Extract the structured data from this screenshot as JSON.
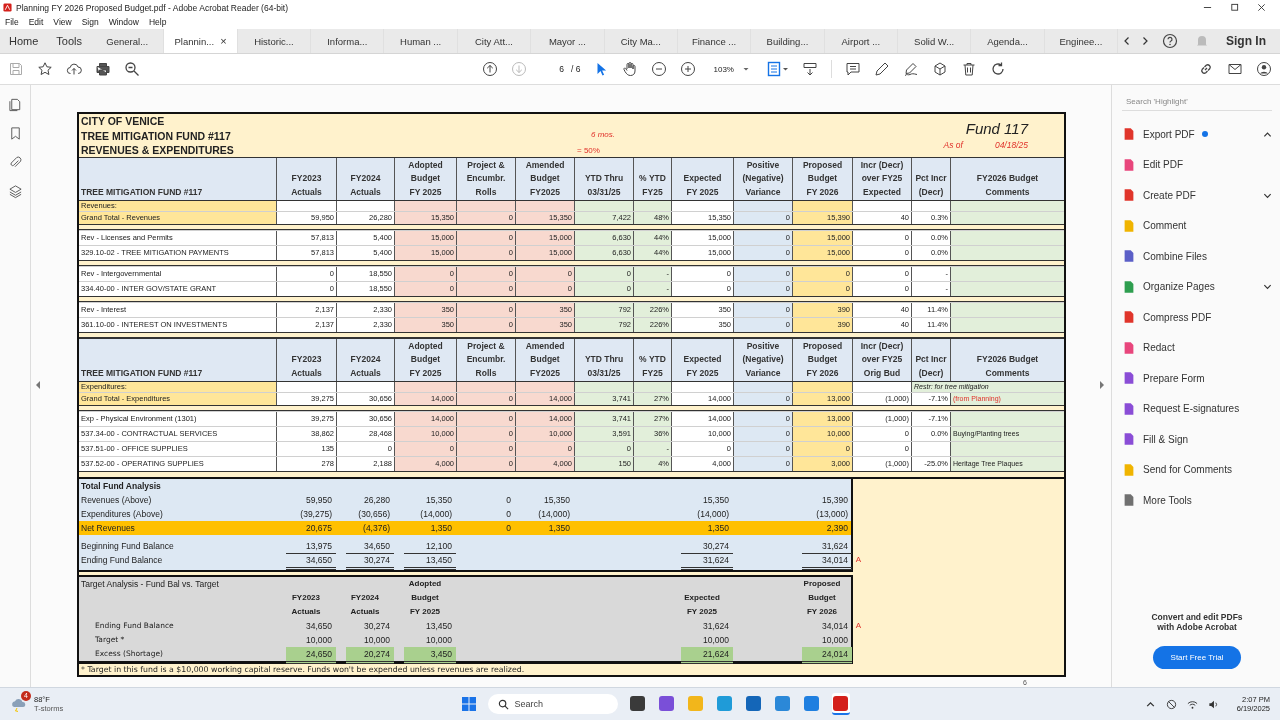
{
  "window": {
    "title": "Planning FY 2026 Proposed Budget.pdf - Adobe Acrobat Reader (64-bit)"
  },
  "menu": [
    "File",
    "Edit",
    "View",
    "Sign",
    "Window",
    "Help"
  ],
  "nav": [
    "Home",
    "Tools"
  ],
  "tabs": [
    {
      "label": "General...",
      "selected": false
    },
    {
      "label": "Plannin...",
      "selected": true,
      "close": "×"
    },
    {
      "label": "Historic...",
      "selected": false
    },
    {
      "label": "Informa...",
      "selected": false
    },
    {
      "label": "Human ...",
      "selected": false
    },
    {
      "label": "City Att...",
      "selected": false
    },
    {
      "label": "Mayor ...",
      "selected": false
    },
    {
      "label": "City Ma...",
      "selected": false
    },
    {
      "label": "Finance ...",
      "selected": false
    },
    {
      "label": "Building...",
      "selected": false
    },
    {
      "label": "Airport ...",
      "selected": false
    },
    {
      "label": "Solid W...",
      "selected": false
    },
    {
      "label": "Agenda...",
      "selected": false
    },
    {
      "label": "Enginee...",
      "selected": false
    }
  ],
  "sign_in": "Sign In",
  "toolbar": {
    "page": "6",
    "pages": "/ 6",
    "zoom": "103%"
  },
  "search": {
    "placeholder": "Search 'Highlight'"
  },
  "tools": [
    {
      "label": "Export PDF",
      "color": "#e0352b",
      "badge": true,
      "expanded": true
    },
    {
      "label": "Edit PDF",
      "color": "#e8467c"
    },
    {
      "label": "Create PDF",
      "color": "#e0352b",
      "expanded": false
    },
    {
      "label": "Comment",
      "color": "#f0b400"
    },
    {
      "label": "Combine Files",
      "color": "#5b5fc7"
    },
    {
      "label": "Organize Pages",
      "color": "#2e9e4f",
      "expanded": false
    },
    {
      "label": "Compress PDF",
      "color": "#e0352b"
    },
    {
      "label": "Redact",
      "color": "#e8467c"
    },
    {
      "label": "Prepare Form",
      "color": "#8a4dd6"
    },
    {
      "label": "Request E-signatures",
      "color": "#8a4dd6"
    },
    {
      "label": "Fill & Sign",
      "color": "#8a4dd6"
    },
    {
      "label": "Send for Comments",
      "color": "#f0b400"
    },
    {
      "label": "More Tools",
      "color": "#707070"
    }
  ],
  "promo": {
    "text": "Convert and edit PDFs with Adobe Acrobat",
    "button": "Start Free Trial"
  },
  "sheet": {
    "title": [
      "CITY OF VENICE",
      "TREE MITIGATION FUND #117",
      "REVENUES & EXPENDITURES"
    ],
    "months": "6 mos.",
    "pct_elapsed": "= 50%",
    "fund": "Fund 117",
    "as_of_label": "As of",
    "as_of": "04/18/25",
    "sections": [
      {
        "headers": [
          [
            "TREE MITIGATION FUND #117"
          ],
          [
            "FY2023",
            "Actuals"
          ],
          [
            "FY2024",
            "Actuals"
          ],
          [
            "Adopted",
            "Budget",
            "FY 2025"
          ],
          [
            "Project &",
            "Encumbr.",
            "Rolls"
          ],
          [
            "Amended",
            "Budget",
            "FY2025"
          ],
          [
            "YTD Thru",
            "03/31/25"
          ],
          [
            "% YTD",
            "FY25"
          ],
          [
            "Expected",
            "FY 2025"
          ],
          [
            "Positive",
            "(Negative)",
            "Variance"
          ],
          [
            "Proposed",
            "Budget",
            "FY 2026"
          ],
          [
            "Incr (Decr)",
            "over FY25",
            "Expected"
          ],
          [
            "Pct Incr",
            "(Decr)"
          ],
          [
            "FY2026 Budget",
            "Comments"
          ]
        ],
        "groups": [
          [
            {
              "kind": "section",
              "label": "Revenues:"
            },
            {
              "kind": "total",
              "label": "Grand Total - Revenues",
              "cells": [
                "59,950",
                "26,280",
                "15,350",
                "0",
                "15,350",
                "7,422",
                "48%",
                "15,350",
                "0",
                "15,390",
                "40",
                "0.3%"
              ]
            }
          ],
          [
            {
              "kind": "line",
              "label": "Rev - Licenses and Permits",
              "cells": [
                "57,813",
                "5,400",
                "15,000",
                "0",
                "15,000",
                "6,630",
                "44%",
                "15,000",
                "0",
                "15,000",
                "0",
                "0.0%"
              ]
            },
            {
              "kind": "line",
              "label": "329.10-02 - TREE MITIGATION PAYMENTS",
              "cells": [
                "57,813",
                "5,400",
                "15,000",
                "0",
                "15,000",
                "6,630",
                "44%",
                "15,000",
                "0",
                "15,000",
                "0",
                "0.0%"
              ]
            }
          ],
          [
            {
              "kind": "line",
              "label": "Rev - Intergovernmental",
              "cells": [
                "0",
                "18,550",
                "0",
                "0",
                "0",
                "0",
                "-",
                "0",
                "0",
                "0",
                "0",
                "-"
              ]
            },
            {
              "kind": "line",
              "label": "334.40-00 - INTER GOV/STATE GRANT",
              "cells": [
                "0",
                "18,550",
                "0",
                "0",
                "0",
                "0",
                "-",
                "0",
                "0",
                "0",
                "0",
                "-"
              ]
            }
          ],
          [
            {
              "kind": "line",
              "label": "Rev - Interest",
              "cells": [
                "2,137",
                "2,330",
                "350",
                "0",
                "350",
                "792",
                "226%",
                "350",
                "0",
                "390",
                "40",
                "11.4%"
              ]
            },
            {
              "kind": "line",
              "label": "361.10-00 - INTEREST ON INVESTMENTS",
              "cells": [
                "2,137",
                "2,330",
                "350",
                "0",
                "350",
                "792",
                "226%",
                "350",
                "0",
                "390",
                "40",
                "11.4%"
              ]
            }
          ]
        ]
      },
      {
        "headers": [
          [
            "TREE MITIGATION FUND #117"
          ],
          [
            "FY2023",
            "Actuals"
          ],
          [
            "FY2024",
            "Actuals"
          ],
          [
            "Adopted",
            "Budget",
            "FY 2025"
          ],
          [
            "Project &",
            "Encumbr.",
            "Rolls"
          ],
          [
            "Amended",
            "Budget",
            "FY2025"
          ],
          [
            "YTD Thru",
            "03/31/25"
          ],
          [
            "% YTD",
            "FY25"
          ],
          [
            "Expected",
            "FY 2025"
          ],
          [
            "Positive",
            "(Negative)",
            "Variance"
          ],
          [
            "Proposed",
            "Budget",
            "FY 2026"
          ],
          [
            "Incr (Decr)",
            "over FY25",
            "Orig Bud"
          ],
          [
            "Pct Incr",
            "(Decr)"
          ],
          [
            "FY2026 Budget",
            "Comments"
          ]
        ],
        "groups": [
          [
            {
              "kind": "section",
              "label": "Expenditures:",
              "note": "Restr: for tree mitigation"
            },
            {
              "kind": "total",
              "label": "Grand Total - Expenditures",
              "comment": "(from Planning)",
              "comment_alert": true,
              "cells": [
                "39,275",
                "30,656",
                "14,000",
                "0",
                "14,000",
                "3,741",
                "27%",
                "14,000",
                "0",
                "13,000",
                "(1,000)",
                "-7.1%"
              ]
            }
          ],
          [
            {
              "kind": "line",
              "label": "Exp - Physical Environment (1301)",
              "cells": [
                "39,275",
                "30,656",
                "14,000",
                "0",
                "14,000",
                "3,741",
                "27%",
                "14,000",
                "0",
                "13,000",
                "(1,000)",
                "-7.1%"
              ]
            },
            {
              "kind": "line",
              "label": "537.34-00 - CONTRACTUAL SERVICES",
              "comment": "Buying/Planting trees",
              "comment_alert": false,
              "cells": [
                "38,862",
                "28,468",
                "10,000",
                "0",
                "10,000",
                "3,591",
                "36%",
                "10,000",
                "0",
                "10,000",
                "0",
                "0.0%"
              ]
            },
            {
              "kind": "line",
              "label": "537.51-00 - OFFICE SUPPLIES",
              "cells": [
                "135",
                "0",
                "0",
                "0",
                "0",
                "0",
                "-",
                "0",
                "0",
                "0",
                "0"
              ]
            },
            {
              "kind": "line",
              "label": "537.52-00 - OPERATING SUPPLIES",
              "comment": "Heritage Tree Plaques",
              "comment_alert": false,
              "cells": [
                "278",
                "2,188",
                "4,000",
                "0",
                "4,000",
                "150",
                "4%",
                "4,000",
                "0",
                "3,000",
                "(1,000)",
                "-25.0%"
              ]
            }
          ]
        ]
      }
    ],
    "fund_analysis": {
      "title": "Total Fund Analysis",
      "rows": [
        {
          "kind": "line",
          "label": "Revenues (Above)",
          "values": {
            "fy2023": "59,950",
            "fy2024": "26,280",
            "adopted": "15,350",
            "project": "0",
            "amended": "15,350",
            "expected": "15,350",
            "proposed": "15,390"
          }
        },
        {
          "kind": "line",
          "label": "Expenditures (Above)",
          "values": {
            "fy2023": "(39,275)",
            "fy2024": "(30,656)",
            "adopted": "(14,000)",
            "project": "0",
            "amended": "(14,000)",
            "expected": "(14,000)",
            "proposed": "(13,000)"
          }
        },
        {
          "kind": "net",
          "label": "Net Revenues",
          "values": {
            "fy2023": "20,675",
            "fy2024": "(4,376)",
            "adopted": "1,350",
            "project": "0",
            "amended": "1,350",
            "expected": "1,350",
            "proposed": "2,390"
          }
        },
        {
          "kind": "opening",
          "label": "Beginning Fund Balance",
          "values": {
            "fy2023": "13,975",
            "fy2024": "34,650",
            "adopted": "12,100",
            "expected": "30,274",
            "proposed": "31,624"
          }
        },
        {
          "kind": "closing",
          "label": "Ending Fund Balance",
          "marker": "A",
          "values": {
            "fy2023": "34,650",
            "fy2024": "30,274",
            "adopted": "13,450",
            "expected": "31,624",
            "proposed": "34,014"
          }
        }
      ]
    },
    "target_analysis": {
      "title": "Target Analysis - Fund Bal vs. Target",
      "headers": {
        "fy2023": [
          "FY2023",
          "Actuals"
        ],
        "fy2024": [
          "FY2024",
          "Actuals"
        ],
        "adopted": [
          "Adopted",
          "Budget",
          "FY 2025"
        ],
        "expected": [
          "Expected",
          "FY 2025"
        ],
        "proposed": [
          "Proposed",
          "Budget",
          "FY 2026"
        ]
      },
      "rows": [
        {
          "kind": "line",
          "label": "Ending Fund Balance",
          "marker": "A",
          "values": {
            "fy2023": "34,650",
            "fy2024": "30,274",
            "adopted": "13,450",
            "expected": "31,624",
            "proposed": "34,014"
          }
        },
        {
          "kind": "line",
          "label": "Target *",
          "values": {
            "fy2023": "10,000",
            "fy2024": "10,000",
            "adopted": "10,000",
            "expected": "10,000",
            "proposed": "10,000"
          }
        },
        {
          "kind": "excess",
          "label": "Excess (Shortage)",
          "values": {
            "fy2023": "24,650",
            "fy2024": "20,274",
            "adopted": "3,450",
            "expected": "21,624",
            "proposed": "24,014"
          }
        }
      ]
    },
    "footnote": "* Target in this fund is a $10,000 working capital reserve. Funds won't be expended unless revenues are realized."
  },
  "page_label": "6",
  "taskbar": {
    "temp": "88°F",
    "weather": "T-storms",
    "badge": "4",
    "search": "Search",
    "apps": [
      {
        "color": "#3a3a3a",
        "selected": false
      },
      {
        "color": "#7a4fd8",
        "selected": false
      },
      {
        "color": "#f2b61b",
        "selected": false
      },
      {
        "color": "#1f9bd8",
        "selected": false
      },
      {
        "color": "#1466b8",
        "selected": false
      },
      {
        "color": "#2b88d8",
        "selected": false
      },
      {
        "color": "#1f7fe0",
        "selected": false
      },
      {
        "color": "#d4201b",
        "selected": true
      }
    ],
    "time": "2:07 PM",
    "date": "6/19/2025"
  }
}
